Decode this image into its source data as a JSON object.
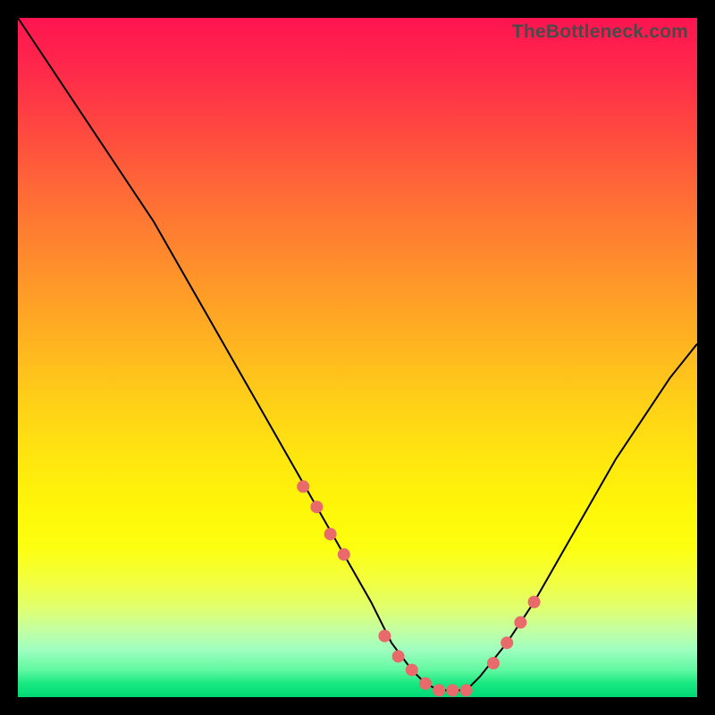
{
  "watermark": "TheBottleneck.com",
  "chart_data": {
    "type": "line",
    "title": "",
    "xlabel": "",
    "ylabel": "",
    "xlim": [
      0,
      100
    ],
    "ylim": [
      0,
      100
    ],
    "series": [
      {
        "name": "bottleneck-curve",
        "x": [
          0,
          4,
          8,
          12,
          16,
          20,
          24,
          28,
          32,
          36,
          40,
          44,
          48,
          52,
          55,
          58,
          60,
          62,
          64,
          66,
          68,
          72,
          76,
          80,
          84,
          88,
          92,
          96,
          100
        ],
        "y": [
          100,
          94,
          88,
          82,
          76,
          70,
          63,
          56,
          49,
          42,
          35,
          28,
          21,
          14,
          8,
          4,
          2,
          1,
          1,
          1,
          3,
          8,
          14,
          21,
          28,
          35,
          41,
          47,
          52
        ]
      }
    ],
    "marker_points": {
      "name": "highlighted-points",
      "x": [
        42,
        44,
        46,
        48,
        54,
        56,
        58,
        60,
        62,
        64,
        66,
        70,
        72,
        74,
        76
      ],
      "y": [
        31,
        28,
        24,
        21,
        9,
        6,
        4,
        2,
        1,
        1,
        1,
        5,
        8,
        11,
        14
      ]
    },
    "gradient_stops": [
      {
        "pos": 0,
        "color": "#ff1450"
      },
      {
        "pos": 50,
        "color": "#ffd018"
      },
      {
        "pos": 80,
        "color": "#fdff10"
      },
      {
        "pos": 100,
        "color": "#00d876"
      }
    ]
  }
}
